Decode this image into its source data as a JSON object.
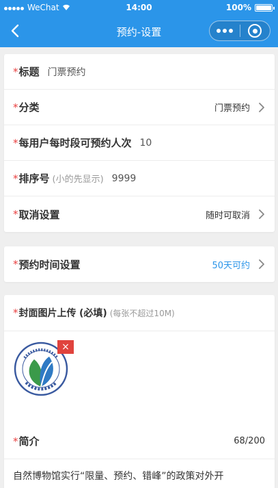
{
  "status_bar": {
    "carrier": "WeChat",
    "time": "14:00",
    "battery": "100%",
    "battery_level": 1.0
  },
  "navbar": {
    "title": "预约-设置",
    "back_icon": "chevron-left-icon",
    "more_icon": "more-dots-icon",
    "close_icon": "target-ring-icon"
  },
  "section_basic": {
    "required_mark": "*",
    "title_label": "标题",
    "title_value": "门票预约",
    "category_label": "分类",
    "category_value": "门票预约",
    "limit_label": "每用户每时段可预约人次",
    "limit_value": "10",
    "sort_label": "排序号",
    "sort_hint": "(小的先显示)",
    "sort_value": "9999",
    "cancel_label": "取消设置",
    "cancel_value": "随时可取消"
  },
  "section_time": {
    "label": "预约时间设置",
    "value": "50天可约",
    "value_color": "#2b95e9"
  },
  "section_media": {
    "upload_label": "封面图片上传",
    "upload_required": "(必填)",
    "upload_hint": "(每张不超过10M)",
    "delete_icon": "×",
    "intro_label": "简介",
    "intro_counter": "68/200",
    "intro_text": "自然博物馆实行“限量、预约、错峰”的政策对外开"
  },
  "colors": {
    "accent": "#2b95e9",
    "required": "#e94141",
    "delete": "#e0433d"
  }
}
